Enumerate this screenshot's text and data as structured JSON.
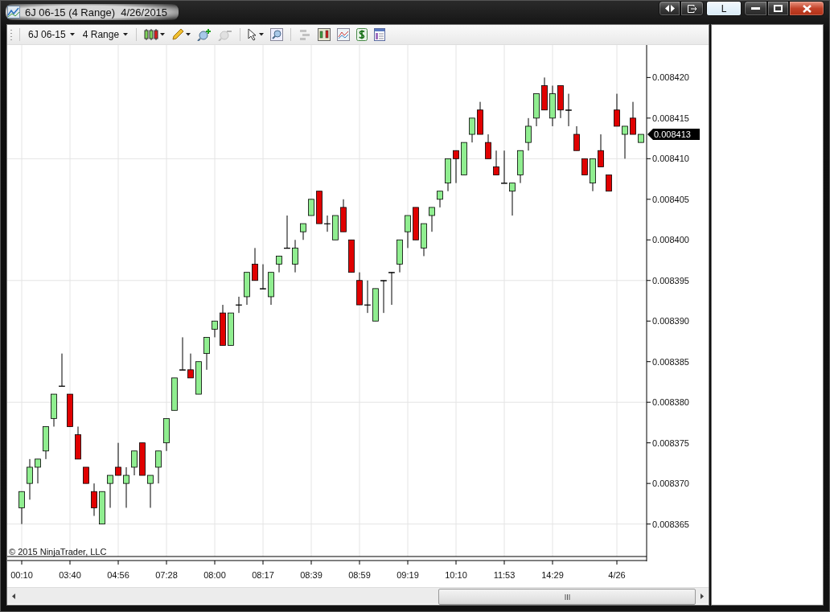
{
  "window": {
    "title": "6J 06-15 (4 Range)  4/26/2015",
    "layout_button": "L"
  },
  "toolbar": {
    "instrument": "6J 06-15",
    "period": "4 Range",
    "tool_groups": [
      [
        {
          "kind": "chart-style",
          "disabled": false
        },
        {
          "kind": "draw",
          "disabled": false
        },
        {
          "kind": "zoom-in",
          "disabled": false
        },
        {
          "kind": "zoom-out",
          "disabled": true
        }
      ],
      [
        {
          "kind": "select",
          "disabled": false
        },
        {
          "kind": "magnify",
          "disabled": false
        }
      ],
      [
        {
          "kind": "align",
          "disabled": true
        },
        {
          "kind": "indicators",
          "disabled": false
        },
        {
          "kind": "strategies",
          "disabled": false
        },
        {
          "kind": "dollar",
          "disabled": false
        },
        {
          "kind": "properties",
          "disabled": false
        }
      ]
    ]
  },
  "chart": {
    "copyright": "© 2015 NinjaTrader, LLC",
    "last_price": "0.008413",
    "chart_data": {
      "type": "candlestick",
      "categories": [
        "00:10",
        null,
        null,
        null,
        null,
        null,
        "03:40",
        null,
        null,
        null,
        null,
        null,
        "04:56",
        null,
        null,
        null,
        null,
        null,
        "07:28",
        null,
        null,
        null,
        null,
        null,
        "08:00",
        null,
        null,
        null,
        null,
        null,
        "08:17",
        null,
        null,
        null,
        null,
        null,
        "08:39",
        null,
        null,
        null,
        null,
        null,
        "08:59",
        null,
        null,
        null,
        null,
        null,
        "09:19",
        null,
        null,
        null,
        null,
        null,
        "10:10",
        null,
        null,
        null,
        null,
        null,
        "11:53",
        null,
        null,
        null,
        null,
        null,
        "14:29",
        null,
        null,
        null,
        null,
        null,
        null,
        null,
        "4/26",
        null,
        null,
        null
      ],
      "ylim": [
        0.008361,
        0.008424
      ],
      "grid": true,
      "yticks": [
        {
          "value": 0.008365,
          "label": "0.008365"
        },
        {
          "value": 0.00837,
          "label": "0.008370"
        },
        {
          "value": 0.008375,
          "label": "0.008375"
        },
        {
          "value": 0.00838,
          "label": "0.008380"
        },
        {
          "value": 0.008385,
          "label": "0.008385"
        },
        {
          "value": 0.00839,
          "label": "0.008390"
        },
        {
          "value": 0.008395,
          "label": "0.008395"
        },
        {
          "value": 0.0084,
          "label": "0.008400"
        },
        {
          "value": 0.008405,
          "label": "0.008405"
        },
        {
          "value": 0.00841,
          "label": "0.008410"
        },
        {
          "value": 0.008415,
          "label": "0.008415"
        },
        {
          "value": 0.00842,
          "label": "0.008420"
        }
      ],
      "ohlc": [
        [
          0.008367,
          0.008369,
          0.008365,
          0.008369
        ],
        [
          0.00837,
          0.008373,
          0.008368,
          0.008372
        ],
        [
          0.008372,
          0.008373,
          0.00837,
          0.008373
        ],
        [
          0.008374,
          0.008377,
          0.008373,
          0.008377
        ],
        [
          0.008378,
          0.008381,
          0.008377,
          0.008381
        ],
        [
          0.008382,
          0.008386,
          0.008382,
          0.008382
        ],
        [
          0.008381,
          0.008381,
          0.008377,
          0.008377
        ],
        [
          0.008376,
          0.008377,
          0.008373,
          0.008373
        ],
        [
          0.008372,
          0.008372,
          0.00837,
          0.00837
        ],
        [
          0.008369,
          0.00837,
          0.008366,
          0.008367
        ],
        [
          0.008365,
          0.008369,
          0.008365,
          0.008369
        ],
        [
          0.00837,
          0.008371,
          0.008367,
          0.008371
        ],
        [
          0.008372,
          0.008375,
          0.008371,
          0.008371
        ],
        [
          0.00837,
          0.008372,
          0.008367,
          0.008371
        ],
        [
          0.008372,
          0.008374,
          0.008371,
          0.008374
        ],
        [
          0.008375,
          0.008375,
          0.008371,
          0.008371
        ],
        [
          0.00837,
          0.008371,
          0.008367,
          0.008371
        ],
        [
          0.008372,
          0.008374,
          0.00837,
          0.008374
        ],
        [
          0.008375,
          0.008378,
          0.008374,
          0.008378
        ],
        [
          0.008379,
          0.008383,
          0.008379,
          0.008383
        ],
        [
          0.008384,
          0.008388,
          0.008384,
          0.008384
        ],
        [
          0.008384,
          0.008386,
          0.008383,
          0.008383
        ],
        [
          0.008381,
          0.008385,
          0.008381,
          0.008385
        ],
        [
          0.008386,
          0.008388,
          0.008384,
          0.008388
        ],
        [
          0.008389,
          0.00839,
          0.008388,
          0.00839
        ],
        [
          0.008391,
          0.008392,
          0.008387,
          0.008387
        ],
        [
          0.008387,
          0.008391,
          0.008387,
          0.008391
        ],
        [
          0.008392,
          0.008393,
          0.008391,
          0.008392
        ],
        [
          0.008393,
          0.008396,
          0.008392,
          0.008396
        ],
        [
          0.008397,
          0.008399,
          0.008395,
          0.008395
        ],
        [
          0.008394,
          0.008397,
          0.008394,
          0.008394
        ],
        [
          0.008393,
          0.008396,
          0.008392,
          0.008396
        ],
        [
          0.008397,
          0.008398,
          0.008396,
          0.008398
        ],
        [
          0.008399,
          0.008403,
          0.008399,
          0.008399
        ],
        [
          0.008397,
          0.0084,
          0.008396,
          0.008399
        ],
        [
          0.008401,
          0.008402,
          0.0084,
          0.008402
        ],
        [
          0.008403,
          0.008405,
          0.008403,
          0.008405
        ],
        [
          0.008406,
          0.008406,
          0.008402,
          0.008402
        ],
        [
          0.008402,
          0.008403,
          0.008401,
          0.008402
        ],
        [
          0.0084,
          0.008403,
          0.0084,
          0.008403
        ],
        [
          0.008404,
          0.008405,
          0.008401,
          0.008401
        ],
        [
          0.0084,
          0.0084,
          0.008396,
          0.008396
        ],
        [
          0.008395,
          0.008396,
          0.008392,
          0.008392
        ],
        [
          0.008392,
          0.008395,
          0.008391,
          0.008392
        ],
        [
          0.00839,
          0.008394,
          0.00839,
          0.008394
        ],
        [
          0.008395,
          0.008395,
          0.008391,
          0.008395
        ],
        [
          0.008396,
          0.008396,
          0.008392,
          0.008396
        ],
        [
          0.008397,
          0.0084,
          0.008396,
          0.0084
        ],
        [
          0.008401,
          0.008403,
          0.008399,
          0.008403
        ],
        [
          0.008404,
          0.008404,
          0.0084,
          0.0084
        ],
        [
          0.008399,
          0.008402,
          0.008398,
          0.008402
        ],
        [
          0.008403,
          0.008404,
          0.008401,
          0.008404
        ],
        [
          0.008405,
          0.008406,
          0.008404,
          0.008406
        ],
        [
          0.008407,
          0.00841,
          0.008406,
          0.00841
        ],
        [
          0.008411,
          0.008411,
          0.008407,
          0.00841
        ],
        [
          0.008408,
          0.008412,
          0.008408,
          0.008412
        ],
        [
          0.008413,
          0.008415,
          0.008412,
          0.008415
        ],
        [
          0.008416,
          0.008417,
          0.008413,
          0.008413
        ],
        [
          0.008412,
          0.008413,
          0.00841,
          0.00841
        ],
        [
          0.008409,
          0.008411,
          0.008408,
          0.008408
        ],
        [
          0.008407,
          0.008411,
          0.008407,
          0.008407
        ],
        [
          0.008406,
          0.008407,
          0.008403,
          0.008407
        ],
        [
          0.008408,
          0.008411,
          0.008407,
          0.008411
        ],
        [
          0.008412,
          0.008415,
          0.008411,
          0.008414
        ],
        [
          0.008415,
          0.008418,
          0.008414,
          0.008418
        ],
        [
          0.008419,
          0.00842,
          0.008416,
          0.008416
        ],
        [
          0.008415,
          0.008419,
          0.008414,
          0.008418
        ],
        [
          0.008419,
          0.008419,
          0.008415,
          0.008416
        ],
        [
          0.008416,
          0.008418,
          0.008414,
          0.008416
        ],
        [
          0.008413,
          0.008414,
          0.008411,
          0.008411
        ],
        [
          0.00841,
          0.00841,
          0.008408,
          0.008408
        ],
        [
          0.008407,
          0.00841,
          0.008406,
          0.00841
        ],
        [
          0.008411,
          0.008413,
          0.008409,
          0.008409
        ],
        [
          0.008408,
          0.008408,
          0.008406,
          0.008406
        ],
        [
          0.008416,
          0.008418,
          0.008414,
          0.008414
        ],
        [
          0.008413,
          0.008414,
          0.00841,
          0.008414
        ],
        [
          0.008415,
          0.008417,
          0.008413,
          0.008413
        ],
        [
          0.008412,
          0.008413,
          0.008412,
          0.008413
        ]
      ]
    }
  }
}
